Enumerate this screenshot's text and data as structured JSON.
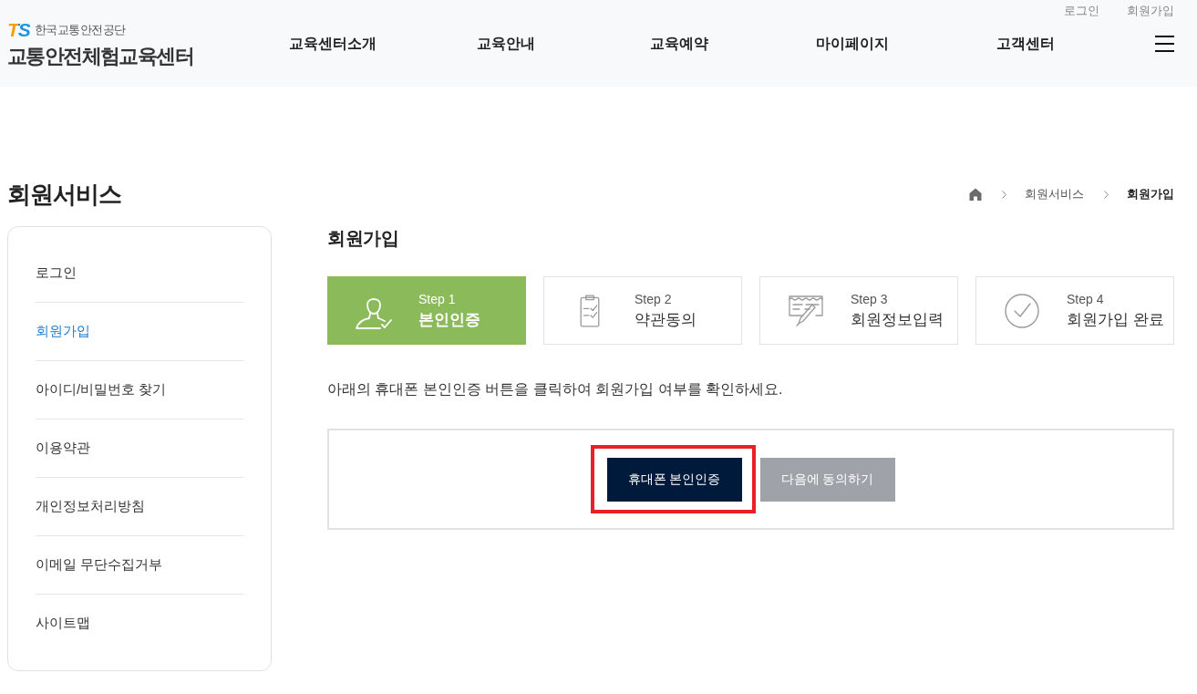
{
  "header": {
    "logo": {
      "mark": "TS",
      "org": "한국교통안전공단",
      "title": "교통안전체험교육센터"
    },
    "utility_links": [
      "로그인",
      "회원가입"
    ],
    "nav": [
      "교육센터소개",
      "교육안내",
      "교육예약",
      "마이페이지",
      "고객센터"
    ]
  },
  "page_title": "회원서비스",
  "breadcrumb": [
    {
      "label": "회원서비스",
      "current": false
    },
    {
      "label": "회원가입",
      "current": true
    }
  ],
  "sidebar": {
    "items": [
      {
        "label": "로그인",
        "selected": false
      },
      {
        "label": "회원가입",
        "selected": true
      },
      {
        "label": "아이디/비밀번호 찾기",
        "selected": false
      },
      {
        "label": "이용약관",
        "selected": false
      },
      {
        "label": "개인정보처리방침",
        "selected": false
      },
      {
        "label": "이메일 무단수집거부",
        "selected": false
      },
      {
        "label": "사이트맵",
        "selected": false
      }
    ]
  },
  "content": {
    "heading": "회원가입",
    "steps": [
      {
        "kind": "identity",
        "step": "Step 1",
        "label": "본인인증",
        "selected": true
      },
      {
        "kind": "terms",
        "step": "Step 2",
        "label": "약관동의",
        "selected": false
      },
      {
        "kind": "form",
        "step": "Step 3",
        "label": "회원정보입력",
        "selected": false
      },
      {
        "kind": "complete",
        "step": "Step 4",
        "label": "회원가입 완료",
        "selected": false
      }
    ],
    "instruction": "아래의 휴대폰 본인인증 버튼을 클릭하여 회원가입 여부를 확인하세요.",
    "buttons": [
      {
        "kind": "primary",
        "label": "휴대폰 본인인증",
        "highlighted": true
      },
      {
        "kind": "secondary",
        "label": "다음에 동의하기",
        "highlighted": false
      }
    ]
  }
}
